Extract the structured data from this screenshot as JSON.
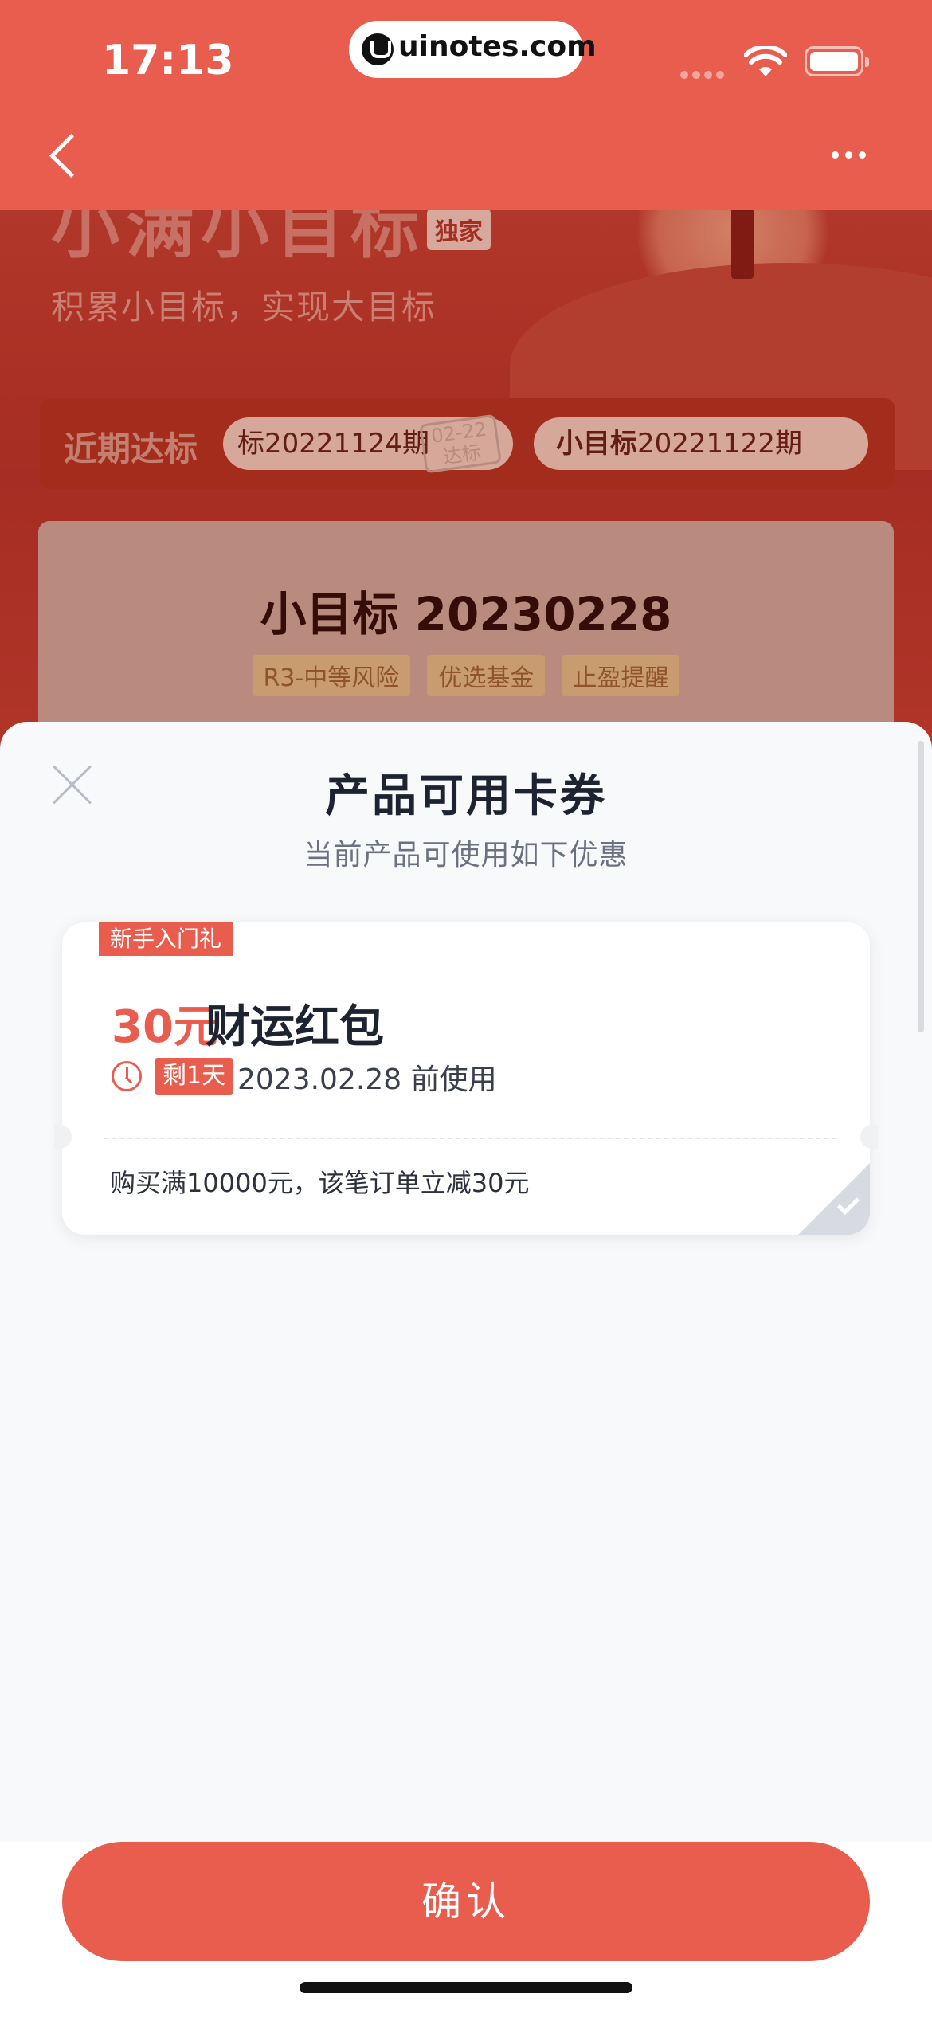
{
  "status_bar": {
    "time": "17:13",
    "url": "uinotes.com"
  },
  "background": {
    "hero_title": "小满小目标",
    "exclusive_badge": "独家",
    "hero_subtitle": "积累小目标，实现大目标",
    "recent_label": "近期达标",
    "recent_pills": [
      {
        "label": "标20221124期",
        "stamp_date": "02-22",
        "stamp_text": "达标"
      },
      {
        "prefix": "小目标",
        "label": "20221122期"
      }
    ],
    "product_title": "小目标 20230228",
    "product_tags": [
      "R3-中等风险",
      "优选基金",
      "止盈提醒"
    ]
  },
  "sheet": {
    "title": "产品可用卡券",
    "subtitle": "当前产品可使用如下优惠",
    "coupon": {
      "badge": "新手入门礼",
      "amount": "30元",
      "name": "财运红包",
      "days_left": "剩1天",
      "expiry": "2023.02.28 前使用",
      "rule": "购买满10000元，该笔订单立减30元",
      "selected": true
    },
    "confirm_label": "确认"
  },
  "colors": {
    "brand": "#e85d4e",
    "title_text": "#1d2330",
    "sheet_bg": "#f8f9fa"
  }
}
